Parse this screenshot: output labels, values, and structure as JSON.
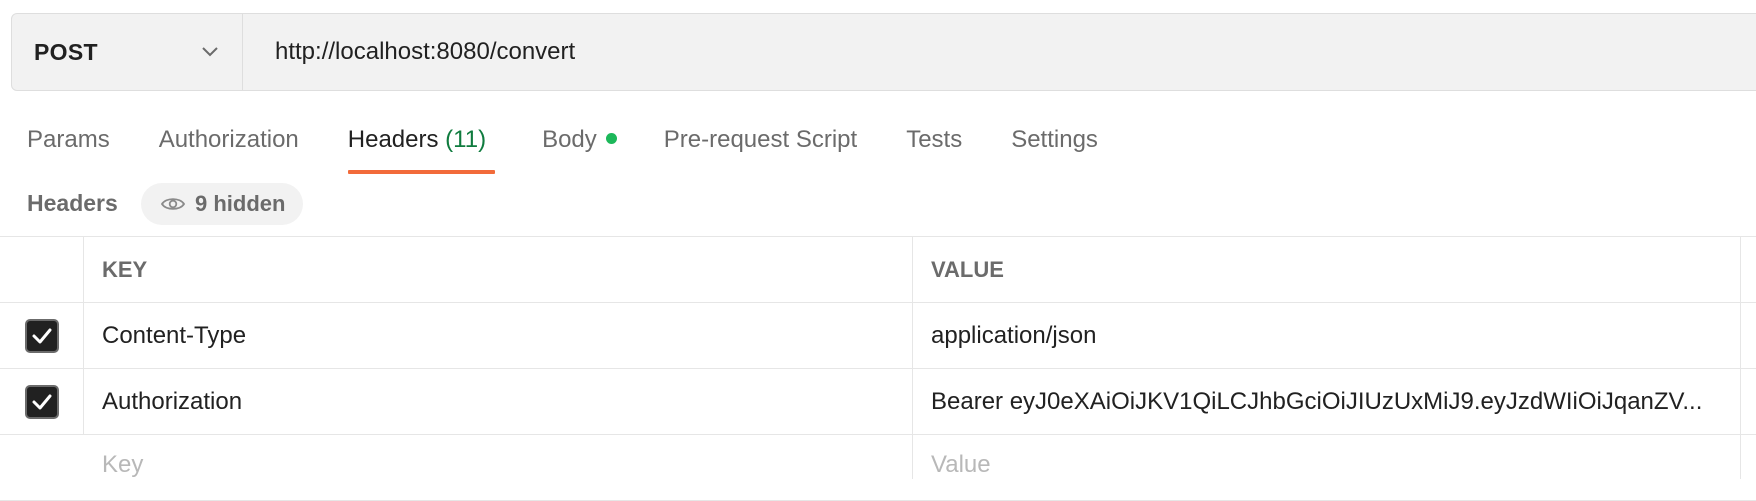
{
  "request": {
    "method": "POST",
    "url": "http://localhost:8080/convert"
  },
  "tabs": [
    {
      "label": "Params"
    },
    {
      "label": "Authorization"
    },
    {
      "label": "Headers",
      "count": "(11)"
    },
    {
      "label": "Body"
    },
    {
      "label": "Pre-request Script"
    },
    {
      "label": "Tests"
    },
    {
      "label": "Settings"
    }
  ],
  "active_tab": "Headers",
  "headers_section": {
    "title": "Headers",
    "hidden_label": "9 hidden"
  },
  "table": {
    "columns": [
      "KEY",
      "VALUE"
    ],
    "rows": [
      {
        "checked": true,
        "key": "Content-Type",
        "value": "application/json"
      },
      {
        "checked": true,
        "key": "Authorization",
        "value": "Bearer eyJ0eXAiOiJKV1QiLCJhbGciOiJIUzUxMiJ9.eyJzdWIiOiJqanZV..."
      }
    ],
    "new_row": {
      "key_placeholder": "Key",
      "value_placeholder": "Value"
    }
  },
  "icons": {
    "method_dropdown": "chevron-down-icon",
    "body_indicator": "dot-icon",
    "hidden_toggle": "eye-icon",
    "checkbox": "check-icon"
  },
  "colors": {
    "active_tab_underline": "#f26b3a",
    "count_text": "#0f7b3e",
    "body_dot": "#1cb85a"
  }
}
